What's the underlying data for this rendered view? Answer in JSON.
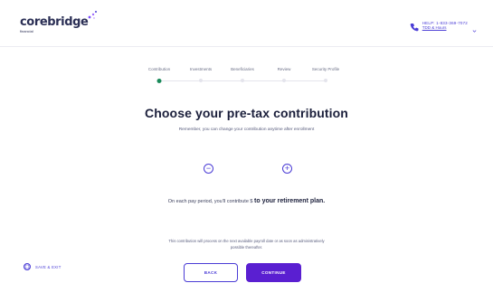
{
  "header": {
    "logo_text": "corebridge",
    "logo_sub": "financial",
    "help_line1": "HELP: 1-833-369-7072",
    "help_line2": "TDD & Hours"
  },
  "steps": [
    {
      "label": "Contribution",
      "active": true
    },
    {
      "label": "Investments",
      "active": false
    },
    {
      "label": "Beneficiaries",
      "active": false
    },
    {
      "label": "Review",
      "active": false
    },
    {
      "label": "Security Profile",
      "active": false
    }
  ],
  "main": {
    "title": "Choose your pre-tax contribution",
    "subtitle": "Remember, you can change your contribution anytime after enrollment",
    "decrement_symbol": "−",
    "increment_symbol": "+",
    "statement_prefix": "On each pay period, you'll contribute $",
    "statement_bold": "to your retirement plan.",
    "note_line1": "This contribution will process on the next available payroll date or as soon as administratively",
    "note_line2": "possible thereafter."
  },
  "footer": {
    "save_exit_label": "SAVE & EXIT",
    "back_label": "BACK",
    "continue_label": "CONTINUE"
  },
  "colors": {
    "accent": "#4a3cd6",
    "primary_button": "#5a1fd1",
    "active_step": "#1a8a5a"
  }
}
